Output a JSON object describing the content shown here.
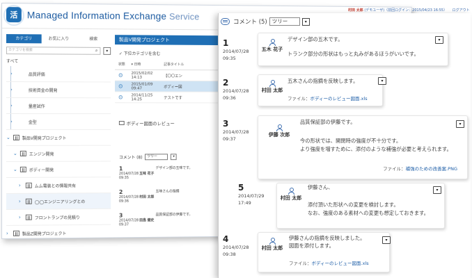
{
  "app": {
    "logo_text": "活",
    "title_main": "Managed Information Exchange ",
    "title_service": "Service"
  },
  "header": {
    "user_name": "村田 太郎",
    "user_info": "(デモユーザ)（前回ログイン：2015/04/23 16:55）",
    "logout": "ログアウト"
  },
  "sidebar": {
    "tabs": [
      "カテゴリ",
      "お気に入り",
      "検索"
    ],
    "search_placeholder": "カテゴリを検索",
    "all_label": "すべて",
    "items": [
      {
        "label": "品質評価"
      },
      {
        "label": "技術資金の開発"
      },
      {
        "label": "量産試作"
      },
      {
        "label": "金型"
      },
      {
        "label": "製品V開発プロジェクト"
      },
      {
        "label": "エンジン開発"
      },
      {
        "label": "ボディー開発"
      },
      {
        "label": "ムム電装との情報共有"
      },
      {
        "label": "◯◯エンジニアリングとの"
      },
      {
        "label": "フロントランプの見積り"
      },
      {
        "label": "製品Z開発プロジェクト"
      }
    ]
  },
  "main": {
    "project_title": "製品V開発プロジェクト",
    "subcategory_check": "下位カテゴリを含む",
    "columns": [
      "状態",
      "日時",
      "記事タイトル"
    ],
    "rows": [
      {
        "date": "2015/02/02 14:13",
        "title": "【〇〇エン"
      },
      {
        "date": "2015/01/09 09:47",
        "title": "ボディー図"
      },
      {
        "date": "2014/11/25 14:25",
        "title": "テストです"
      }
    ],
    "review_title": "ボディー図面のレビュー",
    "comments_label": "コメント (8)",
    "view_mode": "ツリー",
    "mini_entries": [
      {
        "num": "1",
        "date": "2014/07/28 09:35",
        "name": "五味 花子",
        "text": "デザイン部の五味です。"
      },
      {
        "num": "2",
        "date": "2014/07/28 09:36",
        "name": "村田 太郎",
        "text": "五味さんの指摘"
      },
      {
        "num": "3",
        "date": "2014/07/28 09:37",
        "name": "田島 健史",
        "text": "品質保証部の伊藤です。"
      }
    ]
  },
  "comments_panel": {
    "header": "コメント (5)",
    "view_mode": "ツリー",
    "comments": [
      {
        "num": "1",
        "date": "2014/07/28",
        "time": "09:35",
        "name": "五木 花子",
        "lines": [
          "デザイン部の五木です。",
          "トランク部分の形状はもっと丸みがあるほうがいいです。"
        ],
        "file_label": "",
        "file_name": ""
      },
      {
        "num": "2",
        "date": "2014/07/28",
        "time": "09:36",
        "name": "村田 太郎",
        "lines": [
          "五木さんの指摘を反映します。"
        ],
        "file_label": "ファイル：",
        "file_name": "ボディーのレビュー図面.xls"
      },
      {
        "num": "3",
        "date": "2014/07/28",
        "time": "09:37",
        "name": "伊藤 次郎",
        "lines": [
          "品質保証部の伊藤です。",
          "今の形状では、開閉時の強度が不十分です。",
          "より強度を増すために、添付のような補強が必要と考えられます。"
        ],
        "file_label": "ファイル：",
        "file_name": "補強のための改善案.PNG"
      },
      {
        "num": "5",
        "date": "2014/07/29",
        "time": "17:49",
        "name": "村田 太郎",
        "lines": [
          "伊藤さん、",
          "添付頂いた形状への変更を検討します。",
          "なお、強度のある素材への変更も想定しておきます。"
        ],
        "file_label": "",
        "file_name": ""
      },
      {
        "num": "4",
        "date": "2014/07/28",
        "time": "09:38",
        "name": "村田 太郎",
        "lines": [
          "伊藤さんの指摘を反映しました。",
          "図面を添付します。"
        ],
        "file_label": "ファイル：",
        "file_name": "ボディーのレビュー図面.xls"
      }
    ]
  }
}
